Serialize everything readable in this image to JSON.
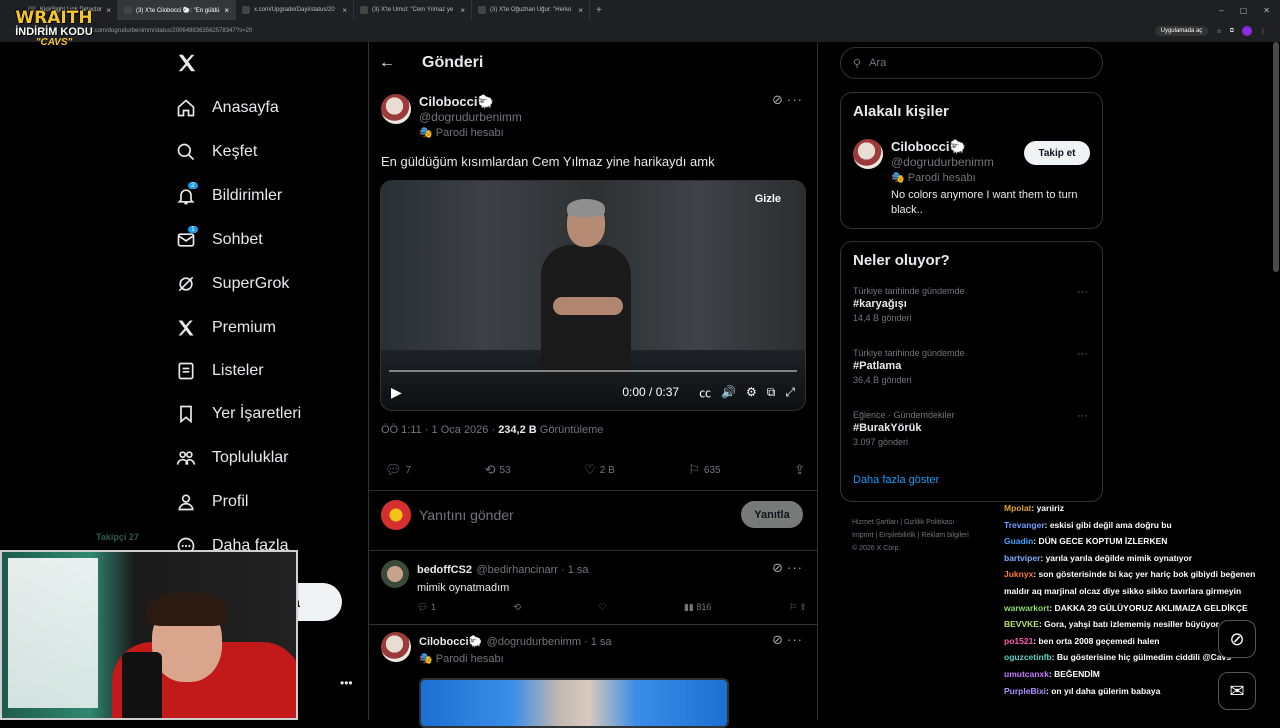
{
  "browser": {
    "tabs": [
      {
        "label": "KickSight Link Detector"
      },
      {
        "label": "(3) X'te Cilobocci 🐑: \"En güldü"
      },
      {
        "label": "x.com/UpgraderDayi/status/20"
      },
      {
        "label": "(3) X'te Umut: \"Cem Yılmaz ye"
      },
      {
        "label": "(3) X'te Oğuzhan Uğur: \"Herko"
      }
    ],
    "url": "x.com/dogrudurbenimm/status/2006488363562578347?s=20",
    "app_pill": "Uygulamada aç"
  },
  "overlay": {
    "brand": "WRAITH",
    "line2": "İNDİRİM KODU",
    "line3": "\"CAVS\"",
    "cam_caption": "Takipçi 27"
  },
  "nav": {
    "items": [
      {
        "label": "Anasayfa"
      },
      {
        "label": "Keşfet"
      },
      {
        "label": "Bildirimler",
        "badge": "2"
      },
      {
        "label": "Sohbet",
        "badge": "1"
      },
      {
        "label": "SuperGrok"
      },
      {
        "label": "Premium"
      },
      {
        "label": "Listeler"
      },
      {
        "label": "Yer İşaretleri"
      },
      {
        "label": "Topluluklar"
      },
      {
        "label": "Profil"
      },
      {
        "label": "Daha fazla"
      }
    ],
    "post_button": "a"
  },
  "header": {
    "title": "Gönderi"
  },
  "tweet": {
    "name": "Cilobocci🐑",
    "handle": "@dogrudurbenimm",
    "parody": "Parodi hesabı",
    "text": "En güldüğüm kısımlardan Cem Yılmaz yine harikaydı amk",
    "video_hide": "Gizle",
    "video_time": "0:00 / 0:37",
    "time": "ÖÖ 1:11 · 1 Oca 2026 · ",
    "views": "234,2 B",
    "views_label": " Görüntüleme",
    "replies": "7",
    "reposts": "53",
    "likes": "2 B",
    "bookmarks": "635"
  },
  "reply": {
    "placeholder": "Yanıtını gönder",
    "button": "Yanıtla"
  },
  "comments": [
    {
      "name": "bedoffCS2",
      "handle": "@bedirhancinarr · 1 sa",
      "text": "mimik oynatmadım",
      "replies": "1",
      "views": "816"
    },
    {
      "name": "Cilobocci🐑",
      "handle": "@dogrudurbenimm · 1 sa",
      "parody": "Parodi hesabı"
    }
  ],
  "sidebar": {
    "search_placeholder": "Ara",
    "related_title": "Alakalı kişiler",
    "related": {
      "name": "Cilobocci🐑",
      "handle": "@dogrudurbenimm",
      "parody": "Parodi hesabı",
      "bio": "No colors anymore I want them to turn black..",
      "follow": "Takip et"
    },
    "trends_title": "Neler oluyor?",
    "trends": [
      {
        "category": "Türkiye tarihinde gündemde",
        "name": "#karyağışı",
        "count": "14,4 B gönderi"
      },
      {
        "category": "Türkiye tarihinde gündemde",
        "name": "#Patlama",
        "count": "36,4 B gönderi"
      },
      {
        "category": "Eğlence · Gündemdekiler",
        "name": "#BurakYörük",
        "count": "3.097 gönderi"
      }
    ],
    "show_more": "Daha fazla göster",
    "footer": [
      "Hizmet Şartları",
      "Gizlilik Politikası",
      "Imprint",
      "Erişilebilirlik",
      "Reklam bilgileri",
      "© 2026 X Corp."
    ]
  },
  "chat": [
    {
      "user": "Mpolat",
      "msg": ": yarıiriz",
      "color": "#e0a030"
    },
    {
      "user": "Trevanger",
      "msg": ": eskisi gibi değil ama doğru bu",
      "color": "#6fa0ff"
    },
    {
      "user": "Guadin",
      "msg": ": DÜN GECE KOPTUM İZLERKEN",
      "color": "#3aa3ff"
    },
    {
      "user": "bartviper",
      "msg": ": yarıla yarıla değilde mimik oynatıyor",
      "color": "#7fb0ff"
    },
    {
      "user": "Juknyx",
      "msg": ": son gösterisinde bi kaç yer hariç bok gibiydi beğenen maldır aq marjinal olcaz diye sikko sikko tavırlara girmeyin",
      "color": "#ff7a3a"
    },
    {
      "user": "warwarkort",
      "msg": ": DAKKA 29 GÜLÜYORUZ AKLIMAIZA GELDİKÇE",
      "color": "#8fd96a"
    },
    {
      "user": "BEVVKE",
      "msg": ": Gora, yahşi batı izlememiş nesiller büyüyor amk",
      "color": "#b6e36a"
    },
    {
      "user": "po1521",
      "msg": ": ben orta 2008 geçemedi halen",
      "color": "#ff5ab4"
    },
    {
      "user": "oguzcetinfb",
      "msg": ": Bu gösterisine hiç gülmedim ciddili @Cavs",
      "color": "#5ad1c9"
    },
    {
      "user": "umutcanxk",
      "msg": ": BEĞENDİM",
      "color": "#c57bff"
    },
    {
      "user": "PurpleBixi",
      "msg": ": on yıl daha gülerim babaya",
      "color": "#b18cff"
    }
  ]
}
